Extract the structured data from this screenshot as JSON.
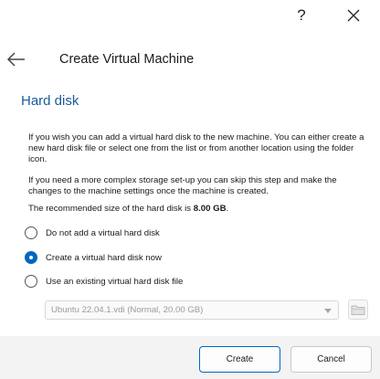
{
  "titlebar": {
    "help_label": "?",
    "help_icon": "question-mark-icon",
    "close_icon": "close-icon"
  },
  "header": {
    "back_icon": "arrow-left-icon",
    "title": "Create Virtual Machine"
  },
  "section": {
    "title": "Hard disk"
  },
  "paragraphs": {
    "intro": "If you wish you can add a virtual hard disk to the new machine. You can either create a new hard disk file or select one from the list or from another location using the folder icon.",
    "advanced": "If you need a more complex storage set-up you can skip this step and make the changes to the machine settings once the machine is created.",
    "recommended_prefix": "The recommended size of the hard disk is ",
    "recommended_size": "8.00 GB",
    "recommended_suffix": "."
  },
  "options": [
    {
      "label": "Do not add a virtual hard disk",
      "checked": false
    },
    {
      "label": "Create a virtual hard disk now",
      "checked": true
    },
    {
      "label": "Use an existing virtual hard disk file",
      "checked": false
    }
  ],
  "existing_disk": {
    "selected": "Ubuntu 22.04.1.vdi (Normal, 20.00 GB)",
    "enabled": false,
    "dropdown_icon": "chevron-down-icon",
    "folder_icon": "folder-icon"
  },
  "footer": {
    "create_label": "Create",
    "cancel_label": "Cancel"
  },
  "colors": {
    "accent": "#0067c0",
    "section_title": "#1a5a9c",
    "footer_bg": "#f3f3f3"
  }
}
